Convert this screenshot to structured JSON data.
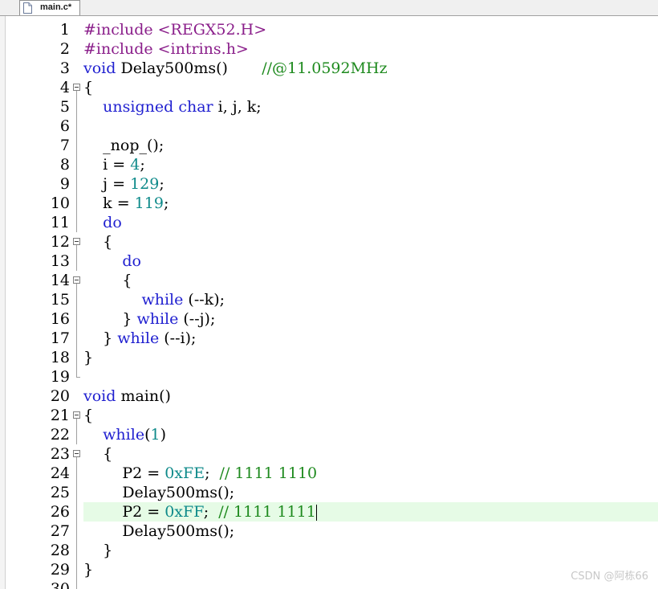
{
  "tab": {
    "label": "main.c*",
    "icon": "file-icon"
  },
  "editor": {
    "current_line": 26,
    "colors": {
      "preprocessor": "#8a1e8a",
      "keyword": "#1f1fd0",
      "number": "#0e8a8a",
      "comment": "#1e8a1e",
      "current_line_bg": "#e6fbe6"
    },
    "lines": [
      {
        "n": "1",
        "fold": "",
        "tokens": [
          {
            "t": "pre",
            "v": "#include <REGX52.H>"
          }
        ]
      },
      {
        "n": "2",
        "fold": "",
        "tokens": [
          {
            "t": "pre",
            "v": "#include <intrins.h>"
          }
        ]
      },
      {
        "n": "3",
        "fold": "",
        "tokens": [
          {
            "t": "kw",
            "v": "void"
          },
          {
            "t": "plain",
            "v": " Delay500ms()       "
          },
          {
            "t": "cmt",
            "v": "//@11.0592MHz"
          }
        ]
      },
      {
        "n": "4",
        "fold": "open",
        "tokens": [
          {
            "t": "plain",
            "v": "{"
          }
        ]
      },
      {
        "n": "5",
        "fold": "line",
        "tokens": [
          {
            "t": "plain",
            "v": "    "
          },
          {
            "t": "kw",
            "v": "unsigned char"
          },
          {
            "t": "plain",
            "v": " i, j, k;"
          }
        ]
      },
      {
        "n": "6",
        "fold": "line",
        "tokens": [
          {
            "t": "plain",
            "v": ""
          }
        ]
      },
      {
        "n": "7",
        "fold": "line",
        "tokens": [
          {
            "t": "plain",
            "v": "    _nop_();"
          }
        ]
      },
      {
        "n": "8",
        "fold": "line",
        "tokens": [
          {
            "t": "plain",
            "v": "    i = "
          },
          {
            "t": "num",
            "v": "4"
          },
          {
            "t": "plain",
            "v": ";"
          }
        ]
      },
      {
        "n": "9",
        "fold": "line",
        "tokens": [
          {
            "t": "plain",
            "v": "    j = "
          },
          {
            "t": "num",
            "v": "129"
          },
          {
            "t": "plain",
            "v": ";"
          }
        ]
      },
      {
        "n": "10",
        "fold": "line",
        "tokens": [
          {
            "t": "plain",
            "v": "    k = "
          },
          {
            "t": "num",
            "v": "119"
          },
          {
            "t": "plain",
            "v": ";"
          }
        ]
      },
      {
        "n": "11",
        "fold": "line",
        "tokens": [
          {
            "t": "plain",
            "v": "    "
          },
          {
            "t": "kw",
            "v": "do"
          }
        ]
      },
      {
        "n": "12",
        "fold": "open",
        "tokens": [
          {
            "t": "plain",
            "v": "    {"
          }
        ]
      },
      {
        "n": "13",
        "fold": "line",
        "tokens": [
          {
            "t": "plain",
            "v": "        "
          },
          {
            "t": "kw",
            "v": "do"
          }
        ]
      },
      {
        "n": "14",
        "fold": "open",
        "tokens": [
          {
            "t": "plain",
            "v": "        {"
          }
        ]
      },
      {
        "n": "15",
        "fold": "line",
        "tokens": [
          {
            "t": "plain",
            "v": "            "
          },
          {
            "t": "kw",
            "v": "while"
          },
          {
            "t": "plain",
            "v": " (--k);"
          }
        ]
      },
      {
        "n": "16",
        "fold": "line",
        "tokens": [
          {
            "t": "plain",
            "v": "        } "
          },
          {
            "t": "kw",
            "v": "while"
          },
          {
            "t": "plain",
            "v": " (--j);"
          }
        ]
      },
      {
        "n": "17",
        "fold": "line",
        "tokens": [
          {
            "t": "plain",
            "v": "    } "
          },
          {
            "t": "kw",
            "v": "while"
          },
          {
            "t": "plain",
            "v": " (--i);"
          }
        ]
      },
      {
        "n": "18",
        "fold": "line",
        "tokens": [
          {
            "t": "plain",
            "v": "}"
          }
        ]
      },
      {
        "n": "19",
        "fold": "end",
        "tokens": [
          {
            "t": "plain",
            "v": ""
          }
        ]
      },
      {
        "n": "20",
        "fold": "",
        "tokens": [
          {
            "t": "kw",
            "v": "void"
          },
          {
            "t": "plain",
            "v": " main()"
          }
        ]
      },
      {
        "n": "21",
        "fold": "open",
        "tokens": [
          {
            "t": "plain",
            "v": "{"
          }
        ]
      },
      {
        "n": "22",
        "fold": "line",
        "tokens": [
          {
            "t": "plain",
            "v": "    "
          },
          {
            "t": "kw",
            "v": "while"
          },
          {
            "t": "plain",
            "v": "("
          },
          {
            "t": "num",
            "v": "1"
          },
          {
            "t": "plain",
            "v": ")"
          }
        ]
      },
      {
        "n": "23",
        "fold": "open",
        "tokens": [
          {
            "t": "plain",
            "v": "    {"
          }
        ]
      },
      {
        "n": "24",
        "fold": "line",
        "tokens": [
          {
            "t": "plain",
            "v": "        P2 = "
          },
          {
            "t": "num",
            "v": "0xFE"
          },
          {
            "t": "plain",
            "v": ";  "
          },
          {
            "t": "cmt",
            "v": "// 1111 1110"
          }
        ]
      },
      {
        "n": "25",
        "fold": "line",
        "tokens": [
          {
            "t": "plain",
            "v": "        Delay500ms();"
          }
        ]
      },
      {
        "n": "26",
        "fold": "line",
        "tokens": [
          {
            "t": "plain",
            "v": "        P2 = "
          },
          {
            "t": "num",
            "v": "0xFF"
          },
          {
            "t": "plain",
            "v": ";  "
          },
          {
            "t": "cmt",
            "v": "// 1111 1111"
          }
        ]
      },
      {
        "n": "27",
        "fold": "line",
        "tokens": [
          {
            "t": "plain",
            "v": "        Delay500ms();"
          }
        ]
      },
      {
        "n": "28",
        "fold": "line",
        "tokens": [
          {
            "t": "plain",
            "v": "    }"
          }
        ]
      },
      {
        "n": "29",
        "fold": "line",
        "tokens": [
          {
            "t": "plain",
            "v": "}"
          }
        ]
      },
      {
        "n": "30",
        "fold": "end",
        "tokens": [
          {
            "t": "plain",
            "v": ""
          }
        ]
      }
    ]
  },
  "watermark": "CSDN @阿栋66"
}
